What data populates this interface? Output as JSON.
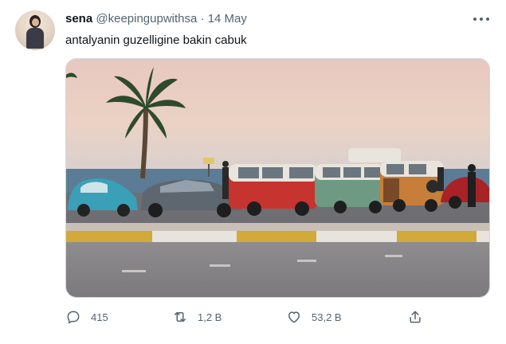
{
  "user": {
    "name": "sena",
    "handle": "@keepingupwithsa",
    "separator": "·",
    "date": "14 May"
  },
  "tweet": {
    "text": "antalyanin guzelligine bakin cabuk"
  },
  "actions": {
    "reply_count": "415",
    "retweet_count": "1,2 B",
    "like_count": "53,2 B"
  },
  "icons": {
    "more": "more-icon",
    "reply": "reply-icon",
    "retweet": "retweet-icon",
    "like": "heart-icon",
    "share": "share-icon"
  },
  "colors": {
    "text": "#0f1419",
    "secondary": "#536471",
    "border": "#cfd9de"
  }
}
